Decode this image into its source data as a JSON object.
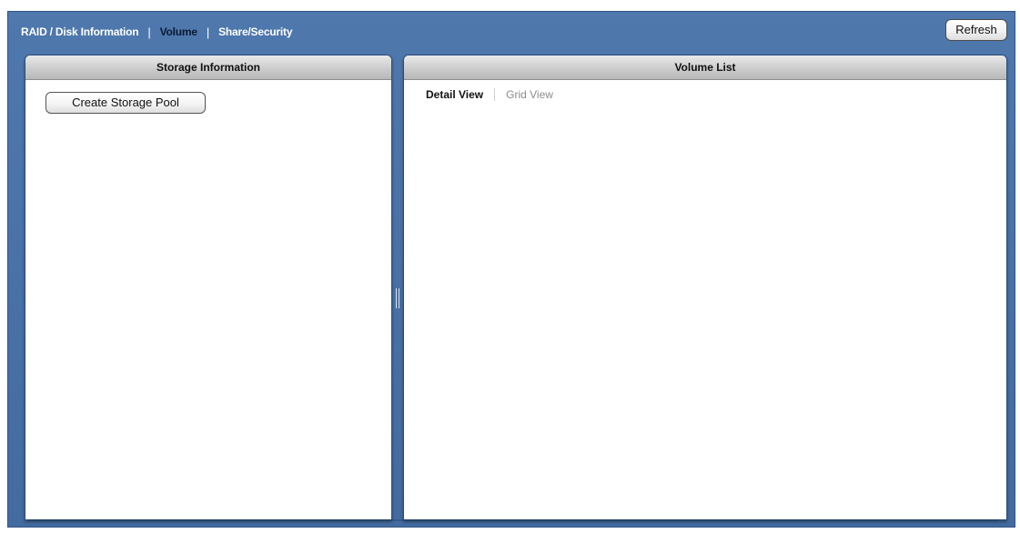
{
  "topnav": {
    "items": [
      {
        "label": "RAID / Disk Information",
        "active": false
      },
      {
        "label": "Volume",
        "active": true
      },
      {
        "label": "Share/Security",
        "active": false
      }
    ],
    "separator": "|"
  },
  "toolbar": {
    "refresh_label": "Refresh"
  },
  "storage_panel": {
    "title": "Storage Information",
    "create_button_label": "Create Storage Pool"
  },
  "volume_panel": {
    "title": "Volume List",
    "tabs": [
      {
        "label": "Detail View",
        "active": true
      },
      {
        "label": "Grid View",
        "active": false
      }
    ]
  },
  "colors": {
    "background": "#4a73a9",
    "active_nav": "#0b1a33",
    "inactive_tab": "#8c8c8c"
  }
}
